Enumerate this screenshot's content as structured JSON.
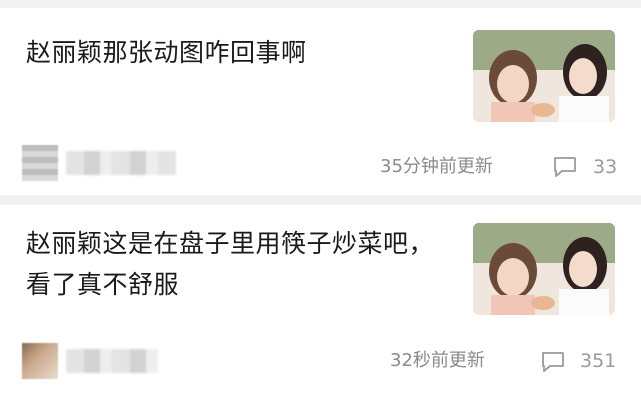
{
  "feed": {
    "posts": [
      {
        "title": "赵丽颖那张动图咋回事啊",
        "time": "35分钟前更新",
        "comment_count": "33",
        "thumbnail_icon": "video-thumbnail"
      },
      {
        "title": "赵丽颖这是在盘子里用筷子炒菜吧，看了真不舒服",
        "time": "32秒前更新",
        "comment_count": "351",
        "thumbnail_icon": "video-thumbnail"
      }
    ]
  },
  "colors": {
    "title_text": "#1a1a1a",
    "meta_text": "#8a8a8a",
    "divider": "#f2f2f2"
  }
}
